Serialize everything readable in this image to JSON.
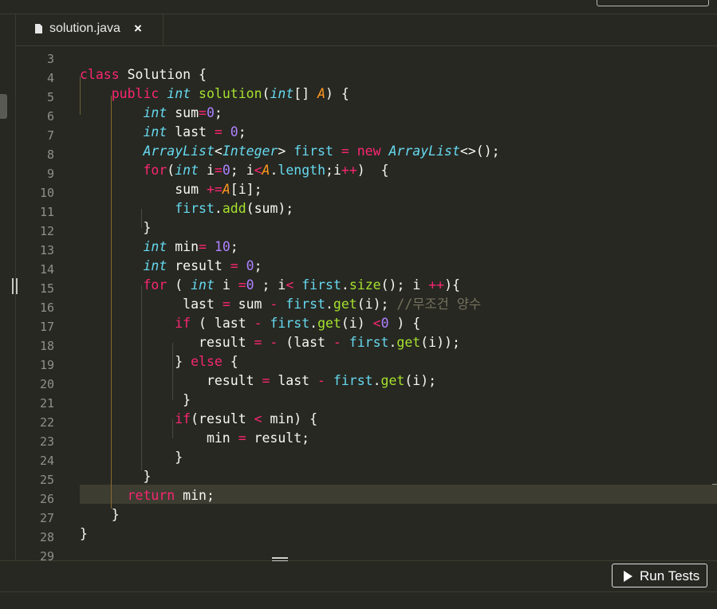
{
  "tab": {
    "filename": "solution.java",
    "close_glyph": "×",
    "icon": "file-icon"
  },
  "editor": {
    "language": "java",
    "cursor_line": 26,
    "line_numbers": [
      "3",
      "4",
      "5",
      "6",
      "7",
      "8",
      "9",
      "10",
      "11",
      "12",
      "13",
      "14",
      "15",
      "16",
      "17",
      "18",
      "19",
      "20",
      "21",
      "22",
      "23",
      "24",
      "25",
      "26",
      "27",
      "28",
      "29"
    ],
    "lines": [
      "",
      "class Solution {",
      "    public int solution(int[] A) {",
      "        int sum=0;",
      "        int last = 0;",
      "        ArrayList<Integer> first = new ArrayList<>();",
      "        for(int i=0; i<A.length;i++)  {",
      "            sum +=A[i];",
      "            first.add(sum);",
      "        }",
      "        int min= 10;",
      "        int result = 0;",
      "        for ( int i =0 ; i< first.size(); i ++){",
      "             last = sum - first.get(i); //무조건 양수",
      "            if ( last - first.get(i) <0 ) {",
      "               result = - (last - first.get(i));",
      "            } else {",
      "                result = last - first.get(i);",
      "             }",
      "            if(result < min) {",
      "                min = result;",
      "            }",
      "        }",
      "      return min;",
      "    }",
      "}",
      ""
    ]
  },
  "bottom": {
    "run_tests_label": "Run Tests",
    "run_icon": "play-icon"
  },
  "colors": {
    "background": "#272822",
    "keyword": "#f92672",
    "type": "#66d9ef",
    "function": "#a6e22e",
    "number": "#ae81ff",
    "param": "#fd971f",
    "comment": "#75715e"
  }
}
